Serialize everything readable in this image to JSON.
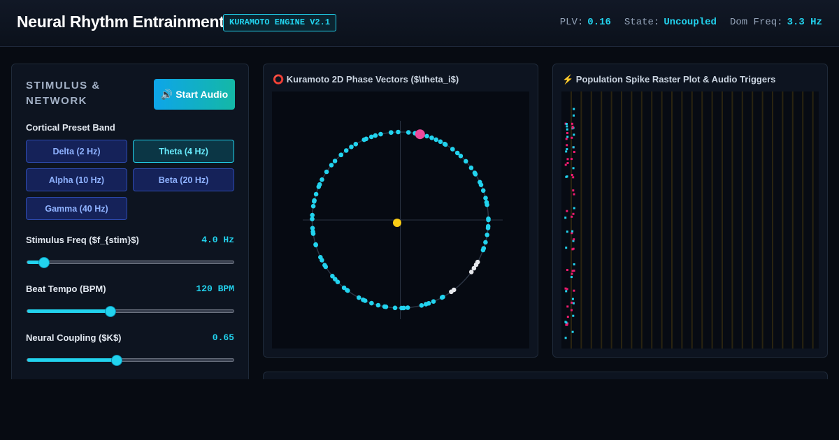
{
  "header": {
    "title": "Neural Rhythm Entrainment",
    "badge": "KURAMOTO ENGINE V2.1",
    "stats": [
      {
        "label": "PLV:",
        "value": "0.16"
      },
      {
        "label": "State:",
        "value": "Uncoupled"
      },
      {
        "label": "Dom Freq:",
        "value": "3.3 Hz"
      }
    ]
  },
  "controls": {
    "title": "STIMULUS & NETWORK",
    "start_button": "🔊 Start Audio",
    "preset_label": "Cortical Preset Band",
    "presets": [
      "Delta (2 Hz)",
      "Theta (4 Hz)",
      "Alpha (10 Hz)",
      "Beta (20 Hz)",
      "Gamma (40 Hz)"
    ],
    "active_preset": 1,
    "sliders": [
      {
        "label": "Stimulus Freq ($f_{stim}$)",
        "value": "4.0 Hz",
        "level": 0.08
      },
      {
        "label": "Beat Tempo (BPM)",
        "value": "120 BPM",
        "level": 0.4
      },
      {
        "label": "Neural Coupling ($K$)",
        "value": "0.65",
        "level": 0.43
      }
    ]
  },
  "phase_panel": {
    "icon": "ring-icon",
    "title": "⭕ Kuramoto 2D Phase Vectors ($\\theta_i$)",
    "colors": {
      "oscillator": "#22d3ee",
      "recent": "#e5e7eb",
      "mean": "#facc15",
      "stimulus": "#ec4899",
      "circle": "#2b3443"
    }
  },
  "raster_panel": {
    "icon": "lightning-icon",
    "title": "⚡ Population Spike Raster Plot & Audio Triggers",
    "colors": {
      "spike_a": "#ec1b6e",
      "spike_b": "#22d3ee",
      "grid": "#2a2410"
    }
  }
}
